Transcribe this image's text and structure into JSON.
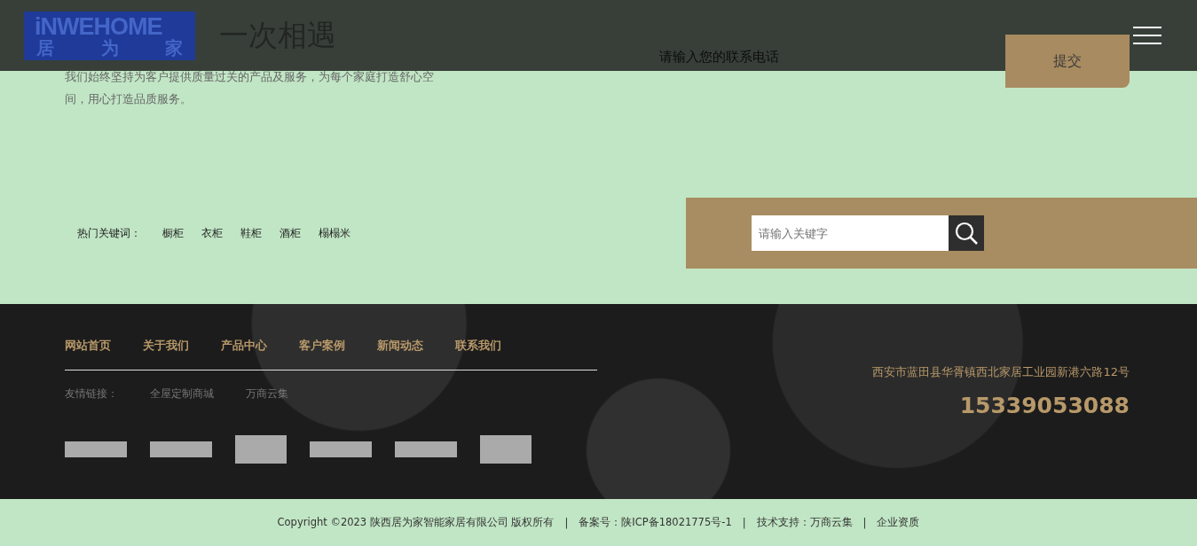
{
  "header": {
    "logo_top": "iNWEHOME",
    "logo_bottom": [
      "居",
      "为",
      "家"
    ]
  },
  "intro": {
    "heading": "一次相遇",
    "text": "我们始终坚持为客户提供质量过关的产品及服务，为每个家庭打造舒心空间，用心打造品质服务。"
  },
  "contact_form": {
    "phone_placeholder": "请输入您的联系电话",
    "submit": "提交"
  },
  "keywords": {
    "label": "热门关键词：",
    "items": [
      "橱柜",
      "衣柜",
      "鞋柜",
      "酒柜",
      "榻榻米"
    ]
  },
  "search": {
    "placeholder": "请输入关键字"
  },
  "footer": {
    "nav": [
      "网站首页",
      "关于我们",
      "产品中心",
      "客户案例",
      "新闻动态",
      "联系我们"
    ],
    "links_label": "友情链接：",
    "links": [
      "全屋定制商城",
      "万商云集"
    ],
    "partner_logos": [
      {
        "kind": "wide"
      },
      {
        "kind": "wide"
      },
      {
        "kind": "square"
      },
      {
        "kind": "wide"
      },
      {
        "kind": "wide"
      },
      {
        "kind": "square"
      }
    ],
    "address": "西安市蓝田县华胥镇西北家居工业园新港六路12号",
    "phone": "15339053088"
  },
  "bottom_separator": "|",
  "bottom_bar": [
    "Copyright ©2023 陕西居为家智能家居有限公司 版权所有",
    "备案号：陕ICP备18021775号-1",
    "技术支持：万商云集",
    "企业资质"
  ]
}
